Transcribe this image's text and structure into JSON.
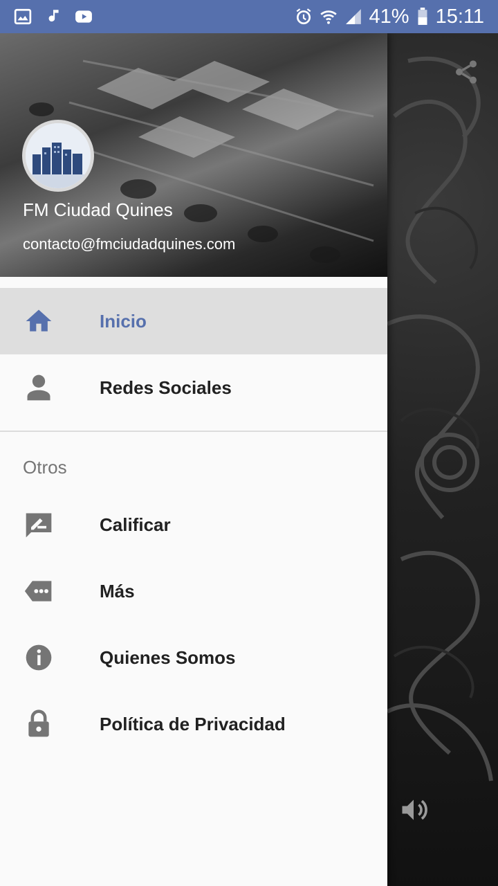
{
  "status_bar": {
    "battery": "41%",
    "time": "15:11"
  },
  "drawer": {
    "header": {
      "title": "FM Ciudad Quines",
      "email": "contacto@fmciudadquines.com"
    },
    "menu_items": [
      {
        "label": "Inicio",
        "icon": "home-icon",
        "active": true
      },
      {
        "label": "Redes Sociales",
        "icon": "person-icon",
        "active": false
      }
    ],
    "section_label": "Otros",
    "other_items": [
      {
        "label": "Calificar",
        "icon": "rate-review-icon"
      },
      {
        "label": "Más",
        "icon": "more-tag-icon"
      },
      {
        "label": "Quienes Somos",
        "icon": "info-icon"
      },
      {
        "label": "Política de Privacidad",
        "icon": "lock-icon"
      }
    ]
  },
  "colors": {
    "accent": "#5670ad",
    "active_row": "#dedede",
    "drawer_bg": "#fafafa"
  }
}
